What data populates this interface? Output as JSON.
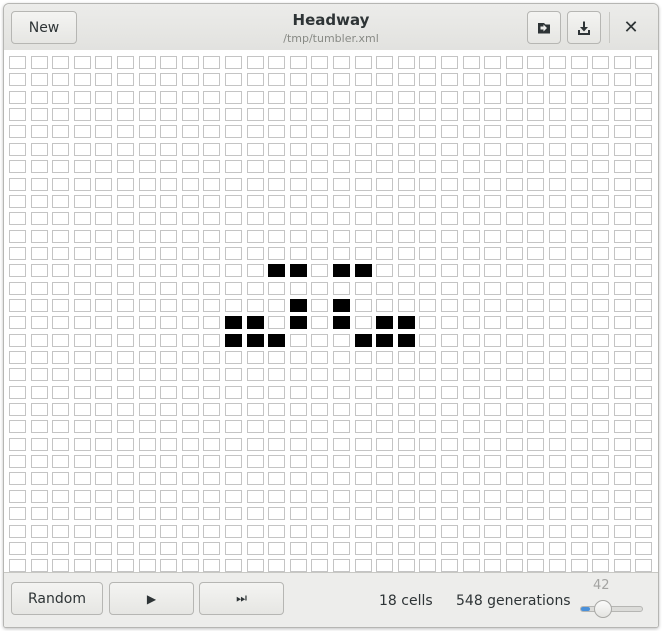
{
  "header": {
    "title": "Headway",
    "subtitle": "/tmp/tumbler.xml",
    "new_label": "New",
    "open_icon": "open-document-icon",
    "save_icon": "download-save-icon",
    "close_icon": "close-icon",
    "close_glyph": "✕"
  },
  "grid": {
    "columns": 30,
    "rows": 30,
    "alive_color": "#000000",
    "dead_color": "#ffffff",
    "border_color": "#c4c4c4",
    "alive_cells": [
      [
        12,
        12
      ],
      [
        12,
        13
      ],
      [
        12,
        15
      ],
      [
        12,
        16
      ],
      [
        14,
        13
      ],
      [
        14,
        15
      ],
      [
        15,
        10
      ],
      [
        15,
        11
      ],
      [
        15,
        13
      ],
      [
        15,
        15
      ],
      [
        15,
        17
      ],
      [
        15,
        18
      ],
      [
        16,
        10
      ],
      [
        16,
        11
      ],
      [
        16,
        12
      ],
      [
        16,
        16
      ],
      [
        16,
        17
      ],
      [
        16,
        18
      ]
    ]
  },
  "footer": {
    "random_label": "Random",
    "play_glyph": "▶",
    "step_glyph": "⏭",
    "cells_text": "18 cells",
    "generations_text": "548 generations",
    "speed_value": "42",
    "speed_fraction": 0.15,
    "accent_color": "#4a90d9"
  }
}
